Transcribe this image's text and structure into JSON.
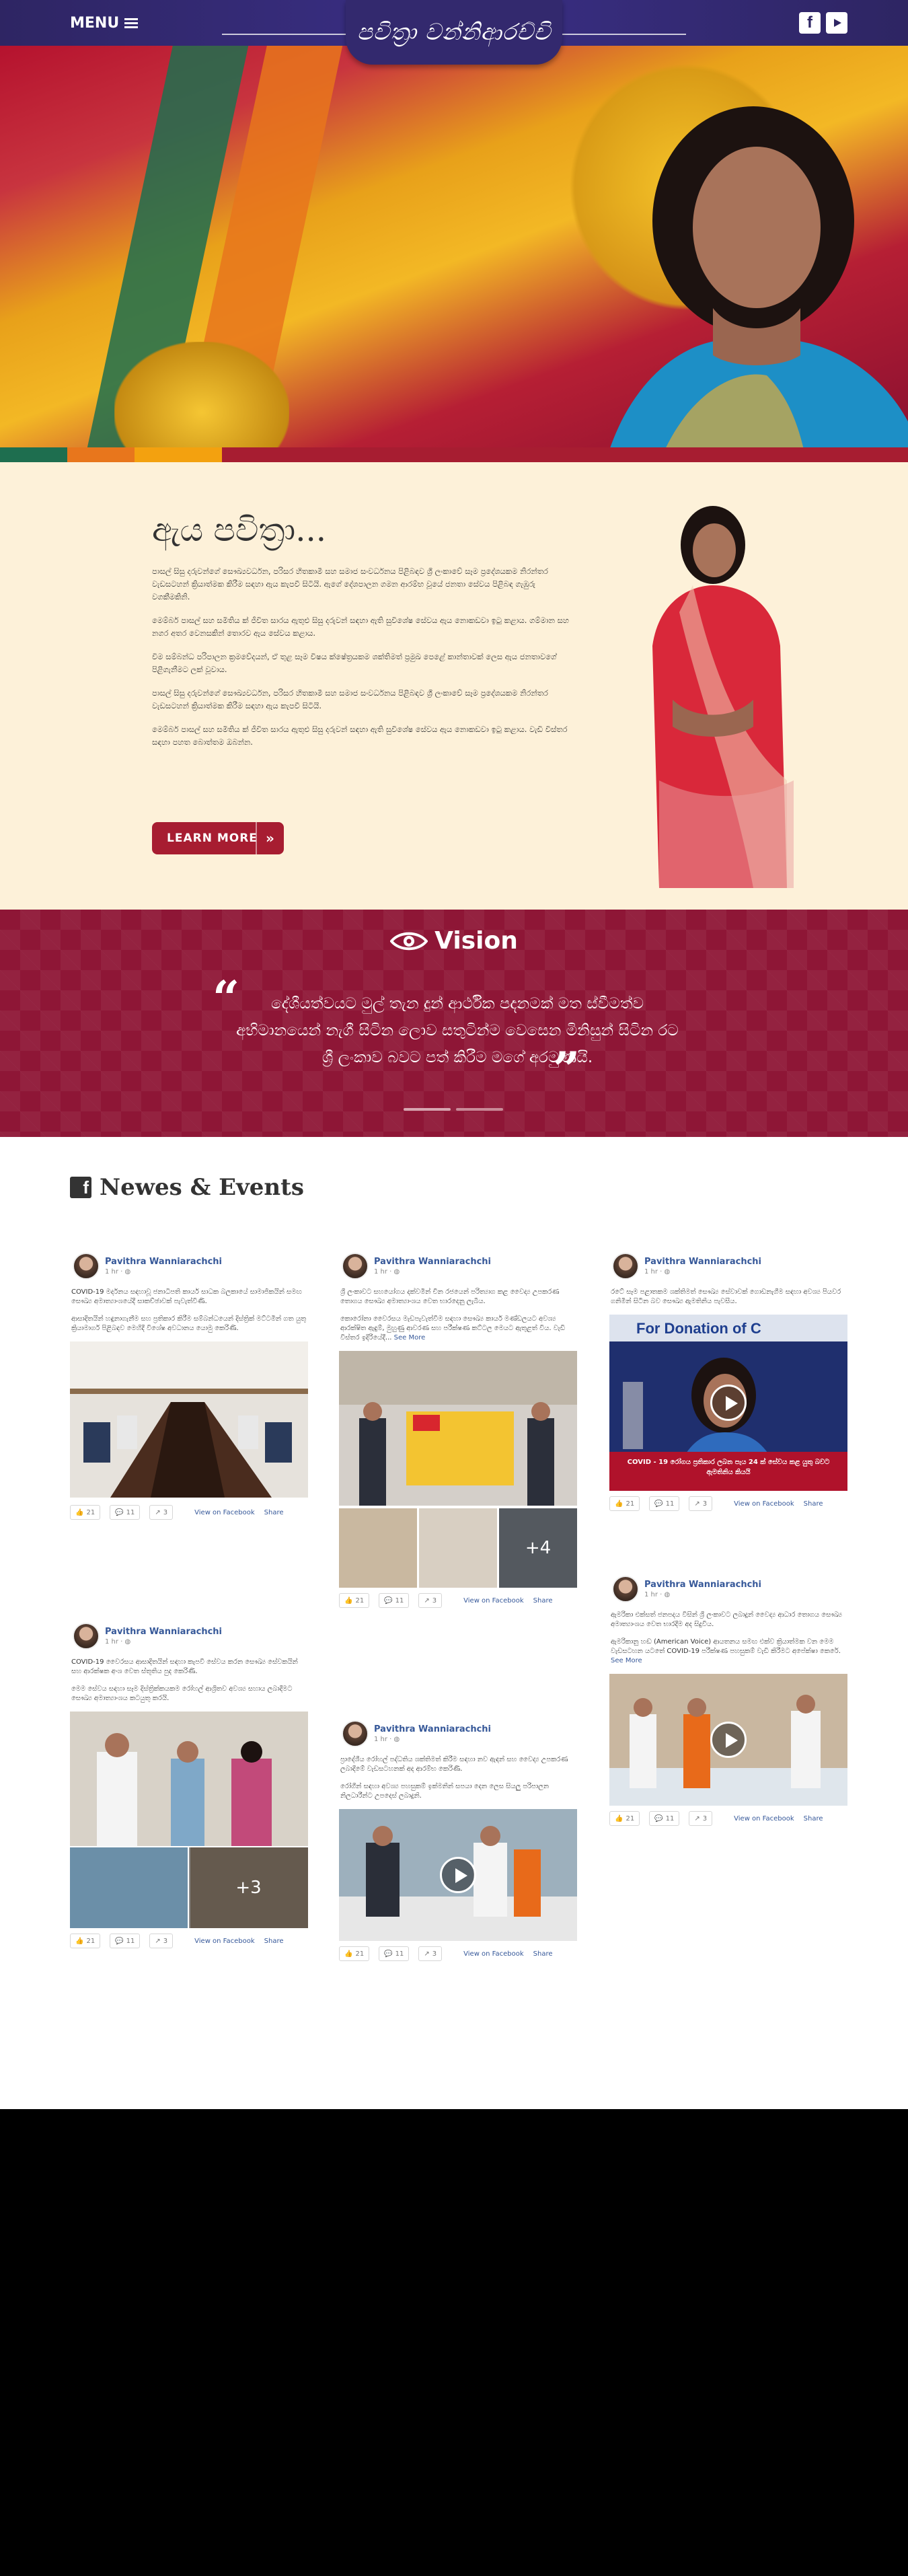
{
  "header": {
    "menu_label": "MENU",
    "logo_text": "පවිත්‍රා වන්නිආරච්චි",
    "social": {
      "facebook": "facebook-icon",
      "youtube": "youtube-icon"
    },
    "colors": {
      "bar": "#2e2563",
      "logo_tab": "#33296e"
    }
  },
  "hero": {
    "stripe_colors": [
      "#1e6e4f",
      "#e8761c",
      "#f3a10f",
      "#a71d31"
    ]
  },
  "about": {
    "title": "ඇය පවිත්‍රා...",
    "paragraphs": [
      "පාසල් සිසු දරුවන්ගේ සෞඛ්‍යවර්ධන, පරිසර හිතකාමී සහ සමාජ සංවර්ධනය පිළිබඳව ශ්‍රී ලංකාවේ සෑම ප්‍රදේශයකම නිරන්තර වැඩසටහන් ක්‍රියාත්මක කිරීම සඳහා ඇය කැපවී සිටියි. ඇගේ දේශපාලන ගමන ආරම්භ වූයේ ජනතා සේවය පිළිබඳ ගැඹුරු වගකීමකිනි.",
      "මෙම්බර් පාසල් සහ සමිතිය ක් ජීවිත සාරය ඇතුළු සිසු දරුවන් සඳහා ඇති සුවිශේෂ සේවය ඇය නොකඩවා ඉටු කළාය. ගම්මාන සහ නගර අතර වෙනසකින් තොරව ඇය සේවය කළාය.",
      "විම සම්බන්ධ පරිපාලන ක්‍රමවේදයන්, ඒ තුළ සෑම විෂය ක්ෂේත්‍රයකම ශක්තිමත් ප්‍රමුඛ පෙළේ කාන්තාවක් ලෙස ඇය ජනතාවගේ පිළිගැනීමට ලක් වූවාය.",
      "පාසල් සිසු දරුවන්ගේ සෞඛ්‍යවර්ධන, පරිසර හිතකාමී සහ සමාජ සංවර්ධනය පිළිබඳව ශ්‍රී ලංකාවේ සෑම ප්‍රදේශයකම නිරන්තර වැඩසටහන් ක්‍රියාත්මක කිරීම සඳහා ඇය කැපවී සිටියි.",
      "මෙම්බර් පාසල් සහ සමිතිය ක් ජීවිත සාරය ඇතුළු සිසු දරුවන් සඳහා ඇති සුවිශේෂ සේවය ඇය නොකඩවා ඉටු කළාය. වැඩි විස්තර සඳහා පහත බොත්තම ඔබන්න."
    ],
    "button_label": "LEARN MORE",
    "button_color": "#a71d31",
    "background": "#fdf1d9"
  },
  "vision": {
    "title": "Vision",
    "quote": "දේශීයත්වයට මුල් තැන දුන් ආර්ථික පදනමක් මත ස්වීමත්ව අභිමානයෙන් නැගී සිටින ලොව සතුටින්ම වෙසෙන මිනිසුන් සිටින රට ශ්‍රී ලංකාව බවට පත් කිරීම මගේ අරමුණයි.",
    "background": "#8e1636"
  },
  "news": {
    "title": "Newes & Events",
    "link_color": "#365899",
    "cards": [
      {
        "author": "Pavithra Wanniarachchi",
        "time": "1 hr",
        "paragraphs": [
          "COVID-19 මර්දනය සඳහාවූ ජනාධිපති කාර්ය සාධක බලකායේ සාමාජිකයින් සමඟ සෞඛ්‍ය අමාත්‍යාංශයේදී සාකච්ඡාවක් පැවැත්විණි.",
          "ආසාදිතයින් හඳුනාගැනීම සහ ප්‍රතිකාර කිරීම සම්බන්ධයෙන් දිස්ත්‍රික් මට්ටමින් ගත යුතු ක්‍රියාමාර්ග පිළිබඳව මෙහිදී විශේෂ අවධානය යොමු කෙරිණි."
        ],
        "likes": "21",
        "comments": "11",
        "shares": "3",
        "view_label": "View on Facebook",
        "share_label": "Share"
      },
      {
        "author": "Pavithra Wanniarachchi",
        "time": "1 hr",
        "paragraphs": [
          "ශ්‍රී ලංකාවට සහයෝගය දක්වමින් චීන රජයෙන් පරිත්‍යාග කළ වෛද්‍ය උපකරණ තොගය සෞඛ්‍ය අමාත්‍යාංශය වෙත භාරදෙනු ලැබීය.",
          "කොරෝනා වෛරසය මැඩපැවැත්වීම සඳහා සෞඛ්‍ය කාර්ය මණ්ඩලයට අවශ්‍ය ආරක්ෂිත ඇඳුම්, මුහුණු ආවරණ සහ පරීක්ෂණ කට්ටල මෙයට ඇතුළත් විය. වැඩි විස්තර ඉදිරියේදී..."
        ],
        "see_more": "See More",
        "likes": "21",
        "comments": "11",
        "shares": "3",
        "view_label": "View on Facebook",
        "share_label": "Share",
        "image_count": "+4"
      },
      {
        "author": "Pavithra Wanniarachchi",
        "time": "1 hr",
        "paragraphs": [
          "රටේ සෑම පළාතකම ශක්තිමත් සෞඛ්‍ය සේවාවක් ගොඩනැගීම සඳහා අවශ්‍ය පියවර ගනිමින් සිටින බව සෞඛ්‍ය ඇමතිනිය පැවසීය."
        ],
        "video_caption_top": "For Donation of C",
        "video_caption": "COVID - 19 රෝගය ප්‍රතිකාර ලබන පැය 24 ක් සේවය කළ යුතු බවට ඇමතිනිය කියයි",
        "likes": "21",
        "comments": "11",
        "shares": "3",
        "view_label": "View on Facebook",
        "share_label": "Share"
      },
      {
        "author": "Pavithra Wanniarachchi",
        "time": "1 hr",
        "paragraphs": [
          "COVID-19 වෛරසය ආසාදිතයින් සඳහා කැපවී සේවය කරන සෞඛ්‍ය සේවකයින් සහ ආරක්ෂක අංශ වෙත ස්තූතිය පුද කෙරිණි.",
          "මෙම සේවය සඳහා සෑම දිස්ත්‍රික්කයකම රෝහල් ආශ්‍රිතව අවශ්‍ය සහාය ලබාදීමට සෞඛ්‍ය අමාත්‍යාංශය කටයුතු කරයි."
        ],
        "likes": "21",
        "comments": "11",
        "shares": "3",
        "view_label": "View on Facebook",
        "share_label": "Share",
        "image_count": "+3"
      },
      {
        "author": "Pavithra Wanniarachchi",
        "time": "1 hr",
        "paragraphs": [
          "ප්‍රාදේශීය රෝහල් පද්ධතිය ශක්තිමත් කිරීම සඳහා නව ඇඳන් සහ වෛද්‍ය උපකරණ ලබාදීමේ වැඩසටහනක් අද ආරම්භ කෙරිණි.",
          "රෝගීන් සඳහා අවශ්‍ය පහසුකම් ඉක්මනින් සපයා දෙන ලෙස සියලු පරිපාලන නිලධාරීන්ට උපදෙස් ලබාදුනි."
        ],
        "likes": "21",
        "comments": "11",
        "shares": "3",
        "view_label": "View on Facebook",
        "share_label": "Share"
      },
      {
        "author": "Pavithra Wanniarachchi",
        "time": "1 hr",
        "paragraphs": [
          "ඇමරිකා එක්සත් ජනපදය විසින් ශ්‍රී ලංකාවට ලබාදුන් වෛද්‍ය ආධාර තොගය සෞඛ්‍ය අමාත්‍යාංශය වෙත භාරදීම අද සිදුවිය.",
          "ඇමරිකානු හඬ (American Voice) ආයතනය සමඟ එක්ව ක්‍රියාත්මක වන මෙම වැඩසටහන යටතේ COVID-19 පරීක්ෂණ පහසුකම් වැඩි කිරීමට අපේක්ෂා කෙරේ."
        ],
        "see_more": "See More",
        "likes": "21",
        "comments": "11",
        "shares": "3",
        "view_label": "View on Facebook",
        "share_label": "Share"
      }
    ]
  }
}
